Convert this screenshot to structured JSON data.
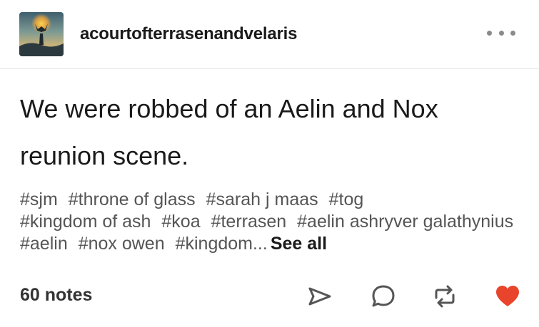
{
  "post": {
    "username": "acourtofterrasenandvelaris",
    "body_lines": [
      "We were robbed of an Aelin and Nox",
      "reunion scene."
    ],
    "tags": [
      "#sjm",
      "#throne of glass",
      "#sarah j maas",
      "#tog",
      "#kingdom of ash",
      "#koa",
      "#terrasen",
      "#aelin ashryver galathynius",
      "#aelin",
      "#nox owen",
      "#kingdom..."
    ],
    "see_all_label": "See all",
    "notes_label": "60 notes"
  },
  "icons": {
    "more": "more-options-icon",
    "share": "send-icon",
    "reply": "reply-bubble-icon",
    "reblog": "reblog-icon",
    "like": "heart-icon"
  },
  "colors": {
    "like": "#e8452c",
    "icon_stroke": "#555555",
    "tag_text": "#555555"
  }
}
